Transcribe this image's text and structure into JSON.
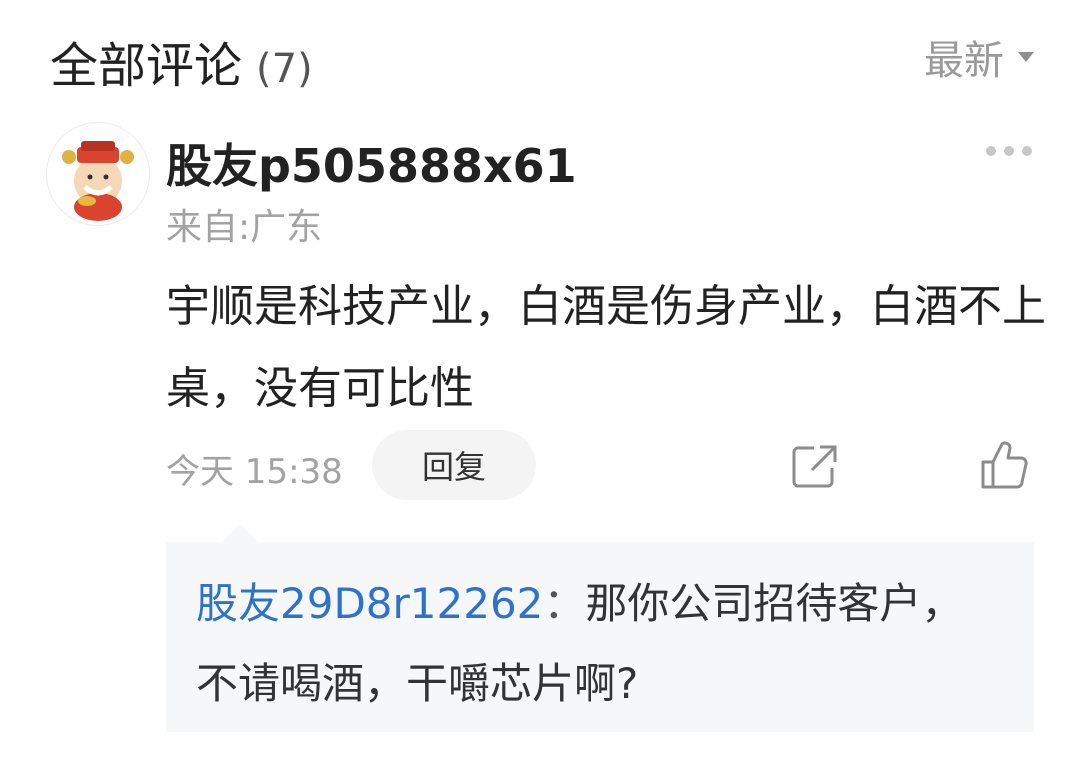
{
  "header": {
    "title": "全部评论",
    "count": "(7)",
    "sort_label": "最新"
  },
  "comment": {
    "author": "股友p505888x61",
    "location": "来自:广东",
    "content": "宇顺是科技产业，白酒是伤身产业，白酒不上桌，没有可比性",
    "time": "今天 15:38",
    "reply_label": "回复",
    "icons": {
      "avatar": "god-of-wealth-avatar",
      "more": "more-dots-icon",
      "share": "share-icon",
      "like": "thumbs-up-icon"
    }
  },
  "reply": {
    "user": "股友29D8r12262",
    "separator": "：",
    "text": "那你公司招待客户，不请喝酒，干嚼芯片啊?"
  },
  "colors": {
    "link_blue": "#2f73c8",
    "muted_gray": "#a3a3a3",
    "reply_bg": "#f6f7f8"
  }
}
